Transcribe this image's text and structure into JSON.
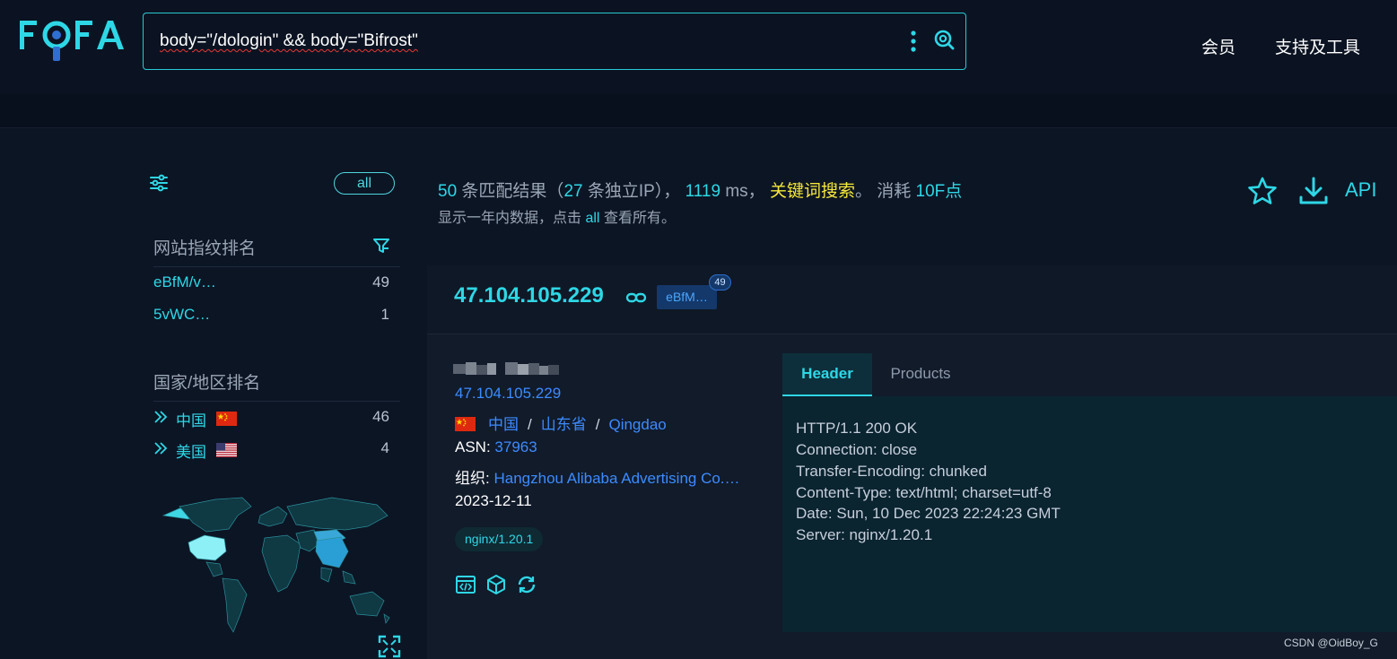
{
  "header": {
    "logo_text": "FOFA",
    "search_query": "body=\"/dologin\" && body=\"Bifrost\"",
    "nav": [
      "会员",
      "支持及工具"
    ]
  },
  "sidebar": {
    "all_label": "all",
    "fingerprint_title": "网站指纹排名",
    "fingerprints": [
      {
        "label": "eBfM/v…",
        "count": "49"
      },
      {
        "label": "5vWC…",
        "count": "1"
      }
    ],
    "country_title": "国家/地区排名",
    "countries": [
      {
        "label": "中国",
        "count": "46"
      },
      {
        "label": "美国",
        "count": "4"
      }
    ]
  },
  "summary": {
    "matches": "50",
    "matches_text": "条匹配结果（",
    "unique_ip": "27",
    "unique_ip_text": "条独立IP），",
    "ms": "1119",
    "ms_text": "ms，",
    "keyword_search": "关键词搜索",
    "cost_text": "。 消耗",
    "points": "10F点",
    "line2_prefix": "显示一年内数据，点击",
    "line2_link": "all",
    "line2_suffix": "查看所有。",
    "api_label": "API"
  },
  "result": {
    "ip": "47.104.105.229",
    "fingerprint_tag": "eBfM…",
    "fingerprint_count": "49",
    "ip_small": "47.104.105.229",
    "country": "中国",
    "province": "山东省",
    "city": "Qingdao",
    "asn_label": "ASN:",
    "asn": "37963",
    "org_label": "组织:",
    "org": "Hangzhou Alibaba Advertising Co.…",
    "date": "2023-12-11",
    "server": "nginx/1.20.1",
    "tabs": [
      "Header",
      "Products"
    ],
    "header_lines": [
      "HTTP/1.1 200 OK",
      "Connection: close",
      "Transfer-Encoding: chunked",
      "Content-Type: text/html; charset=utf-8",
      "Date: Sun, 10 Dec 2023 22:24:23 GMT",
      "Server: nginx/1.20.1"
    ]
  },
  "watermark": "CSDN @OidBoy_G",
  "colors": {
    "accent": "#2ed7e6",
    "link": "#3d8bff",
    "highlight": "#f6e83a",
    "background": "#0c1524"
  }
}
